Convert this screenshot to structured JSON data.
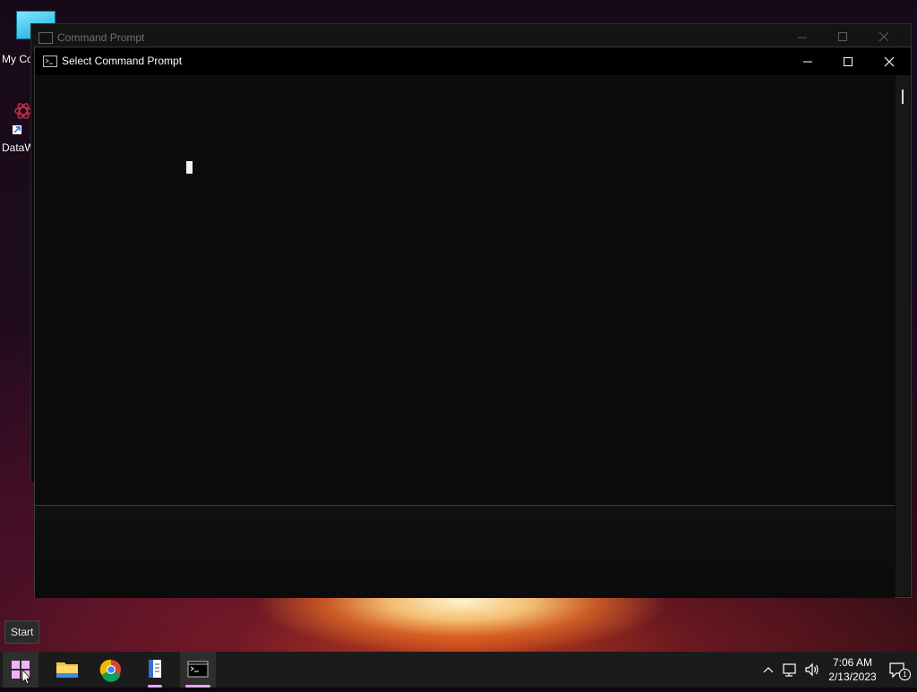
{
  "desktop": {
    "icons": [
      {
        "label": "My Co",
        "icon": "computer-icon"
      },
      {
        "label": "DataW",
        "icon": "datawarrior-shortcut-icon"
      }
    ]
  },
  "windows": {
    "background": {
      "title": "Command Prompt",
      "icon": "cmd-icon",
      "state": "inactive"
    },
    "foreground": {
      "title": "Select Command Prompt",
      "icon": "cmd-icon",
      "state": "active",
      "console_text": ""
    }
  },
  "tooltip": {
    "text": "Start"
  },
  "taskbar": {
    "buttons": [
      {
        "name": "start",
        "icon": "windows-logo-icon"
      },
      {
        "name": "file-explorer",
        "icon": "folder-icon"
      },
      {
        "name": "chrome",
        "icon": "chrome-icon"
      },
      {
        "name": "notepad-app",
        "icon": "notepad-icon"
      },
      {
        "name": "command-prompt",
        "icon": "cmd-icon",
        "active": true
      }
    ],
    "clock": {
      "time": "7:06 AM",
      "date": "2/13/2023"
    },
    "notifications": {
      "count": "1"
    }
  },
  "colors": {
    "accent": "#e7a6f0",
    "console_bg": "#0c0c0c",
    "taskbar_bg": "#1b1b1b"
  }
}
